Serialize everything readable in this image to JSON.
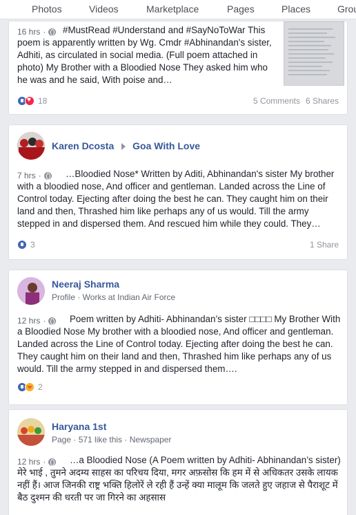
{
  "tabs": [
    "Photos",
    "Videos",
    "Marketplace",
    "Pages",
    "Places",
    "Grou"
  ],
  "posts": [
    {
      "time": "16 hrs",
      "text": "#MustRead #Understand and #SayNoToWar This poem is apparently written by Wg. Cmdr #Abhinandan's sister, Adhiti, as circulated in social media. (Full poem attached in photo) My Brother with a Bloodied Nose They asked him who he was and he said, With poise and…",
      "reactions": "18",
      "comments": "5 Comments",
      "shares": "6 Shares"
    },
    {
      "author": "Karen Dcosta",
      "group": "Goa With Love",
      "time": "7 hrs",
      "text": "…Bloodied Nose* Written by Aditi, Abhinandan's sister My brother with a bloodied nose, And officer and gentleman. Landed across the Line of Control today. Ejecting after doing the best he can. They caught him on their land and then, Thrashed him like perhaps any of us would. Till the army stepped in and dispersed them. And rescued him while they could. They…",
      "reactions": "3",
      "shares": "1 Share"
    },
    {
      "author": "Neeraj Sharma",
      "subtitle": "Profile · Works at Indian Air Force",
      "time": "12 hrs",
      "text": "Poem written by Adhiti- Abhinandan’s sister □□□□ My Brother With a Bloodied Nose My brother with a bloodied nose, And officer and gentleman. Landed across the Line of Control today. Ejecting after doing the best he can. They caught him on their land and then, Thrashed him like perhaps any of us would. Till the army stepped in and dispersed them….",
      "reactions": "2"
    },
    {
      "author": "Haryana 1st",
      "subtitle": "Page · 571 like this · Newspaper",
      "time": "12 hrs",
      "text": "…a Bloodied Nose (A Poem written by Adhiti- Abhinandan’s sister) मेरे भाई , तुमने अदम्य साहस का परिचय दिया, मगर अफ़सोस कि हम में से अधिकतर उसके लायक नहीं हैं। आज जिनकी राष्ट्र भक्ति हिलोरें ले रही हैं उन्हें क्या मालूम कि जलते हुए जहाज से पैराशूट में बैठ दुश्मन की धरती पर जा गिरने का अहसास"
    }
  ],
  "colors": {
    "link": "#365899",
    "like": "#4267b2",
    "love": "#f0284a",
    "angry": "#f7b125"
  }
}
